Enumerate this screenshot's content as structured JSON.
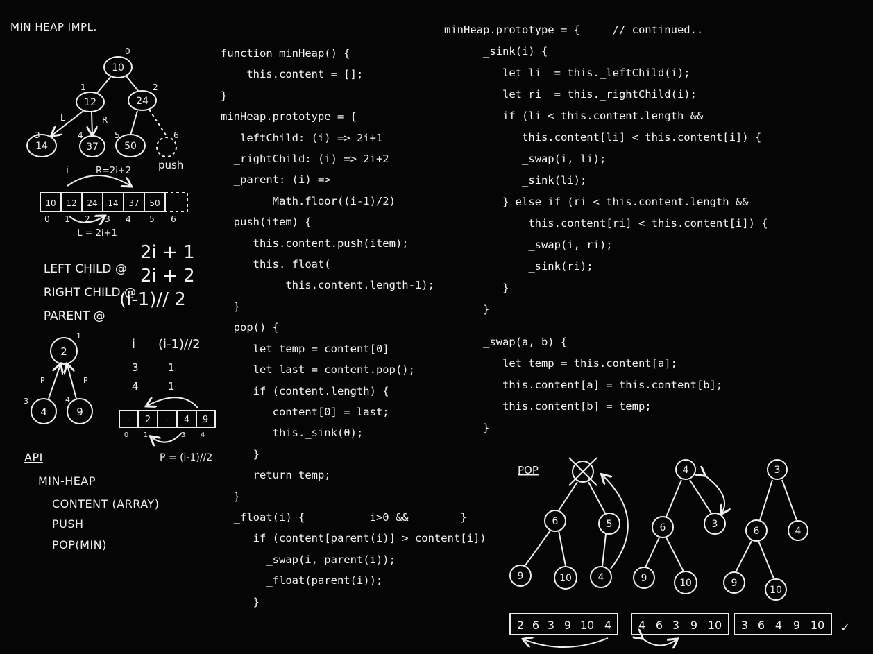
{
  "title": "MIN HEAP IMPL.",
  "tree1": {
    "nodes": [
      "10",
      "12",
      "24",
      "14",
      "37",
      "50"
    ],
    "indices": [
      "0",
      "1",
      "2",
      "3",
      "4",
      "5",
      "6"
    ],
    "edge_labels": {
      "left": "L",
      "right": "R"
    },
    "push_label": "push"
  },
  "array1": {
    "cells": [
      "10",
      "12",
      "24",
      "14",
      "37",
      "50",
      ""
    ],
    "indices": [
      "0",
      "1",
      "2",
      "3",
      "4",
      "5",
      "6"
    ],
    "i_label": "i",
    "right_formula": "R=2i+2",
    "left_formula": "L = 2i+1"
  },
  "formulas": [
    {
      "label": "LEFT CHILD @",
      "expr": "2i + 1"
    },
    {
      "label": "RIGHT CHILD @",
      "expr": "2i + 2"
    },
    {
      "label": "PARENT @",
      "expr": "(i-1)// 2"
    }
  ],
  "tree2": {
    "nodes": [
      "2",
      "4",
      "9"
    ],
    "indices": [
      "1",
      "3",
      "4"
    ],
    "edge_label": "P"
  },
  "parent_table": {
    "headers": [
      "i",
      "(i-1)//2"
    ],
    "rows": [
      [
        "3",
        "1"
      ],
      [
        "4",
        "1"
      ]
    ]
  },
  "array2": {
    "cells": [
      "-",
      "2",
      "-",
      "4",
      "9"
    ],
    "indices": [
      "0",
      "1",
      "3",
      "4"
    ],
    "formula": "P = (i-1)//2"
  },
  "api": {
    "heading": "API",
    "items": [
      "MIN-HEAP",
      "CONTENT (ARRAY)",
      "PUSH",
      "POP(MIN)"
    ]
  },
  "code_middle": [
    "function minHeap() {",
    "    this.content = [];",
    "}",
    "minHeap.prototype = {",
    "  _leftChild: (i) => 2i+1",
    "  _rightChild: (i) => 2i+2",
    "  _parent: (i) =>",
    "        Math.floor((i-1)/2)",
    "  push(item) {",
    "     this.content.push(item);",
    "     this._float(",
    "          this.content.length-1);",
    "  }",
    "  pop() {",
    "     let temp = content[0]",
    "     let last = content.pop();",
    "     if (content.length) {",
    "        content[0] = last;",
    "        this._sink(0);",
    "     }",
    "     return temp;",
    "  }",
    "  _float(i) {          i>0 &&        }",
    "     if (content[parent(i)] > content[i])",
    "       _swap(i, parent(i));",
    "       _float(parent(i));",
    "     }"
  ],
  "code_right": [
    "minHeap.prototype = {     // continued..",
    "      _sink(i) {",
    "         let li  = this._leftChild(i);",
    "         let ri  = this._rightChild(i);",
    "         if (li < this.content.length &&",
    "            this.content[li] < this.content[i]) {",
    "            _swap(i, li);",
    "            _sink(li);",
    "         } else if (ri < this.content.length &&",
    "             this.content[ri] < this.content[i]) {",
    "             _swap(i, ri);",
    "             _sink(ri);",
    "         }",
    "      }",
    "",
    "      _swap(a, b) {",
    "         let temp = this.content[a];",
    "         this.content[a] = this.content[b];",
    "         this.content[b] = temp;",
    "      }"
  ],
  "pop_demo": {
    "heading": "POP",
    "tree_a": {
      "root": "X",
      "nodes": [
        "6",
        "5",
        "9",
        "10",
        "4"
      ]
    },
    "tree_b": {
      "nodes": [
        "4",
        "6",
        "3",
        "9",
        "10"
      ]
    },
    "tree_c": {
      "nodes": [
        "3",
        "6",
        "4",
        "9",
        "10"
      ]
    },
    "arrays": [
      [
        "2",
        "6",
        "3",
        "9",
        "10",
        "4"
      ],
      [
        "4",
        "6",
        "3",
        "9",
        "10"
      ],
      [
        "3",
        "6",
        "4",
        "9",
        "10"
      ]
    ],
    "check": "✓"
  }
}
